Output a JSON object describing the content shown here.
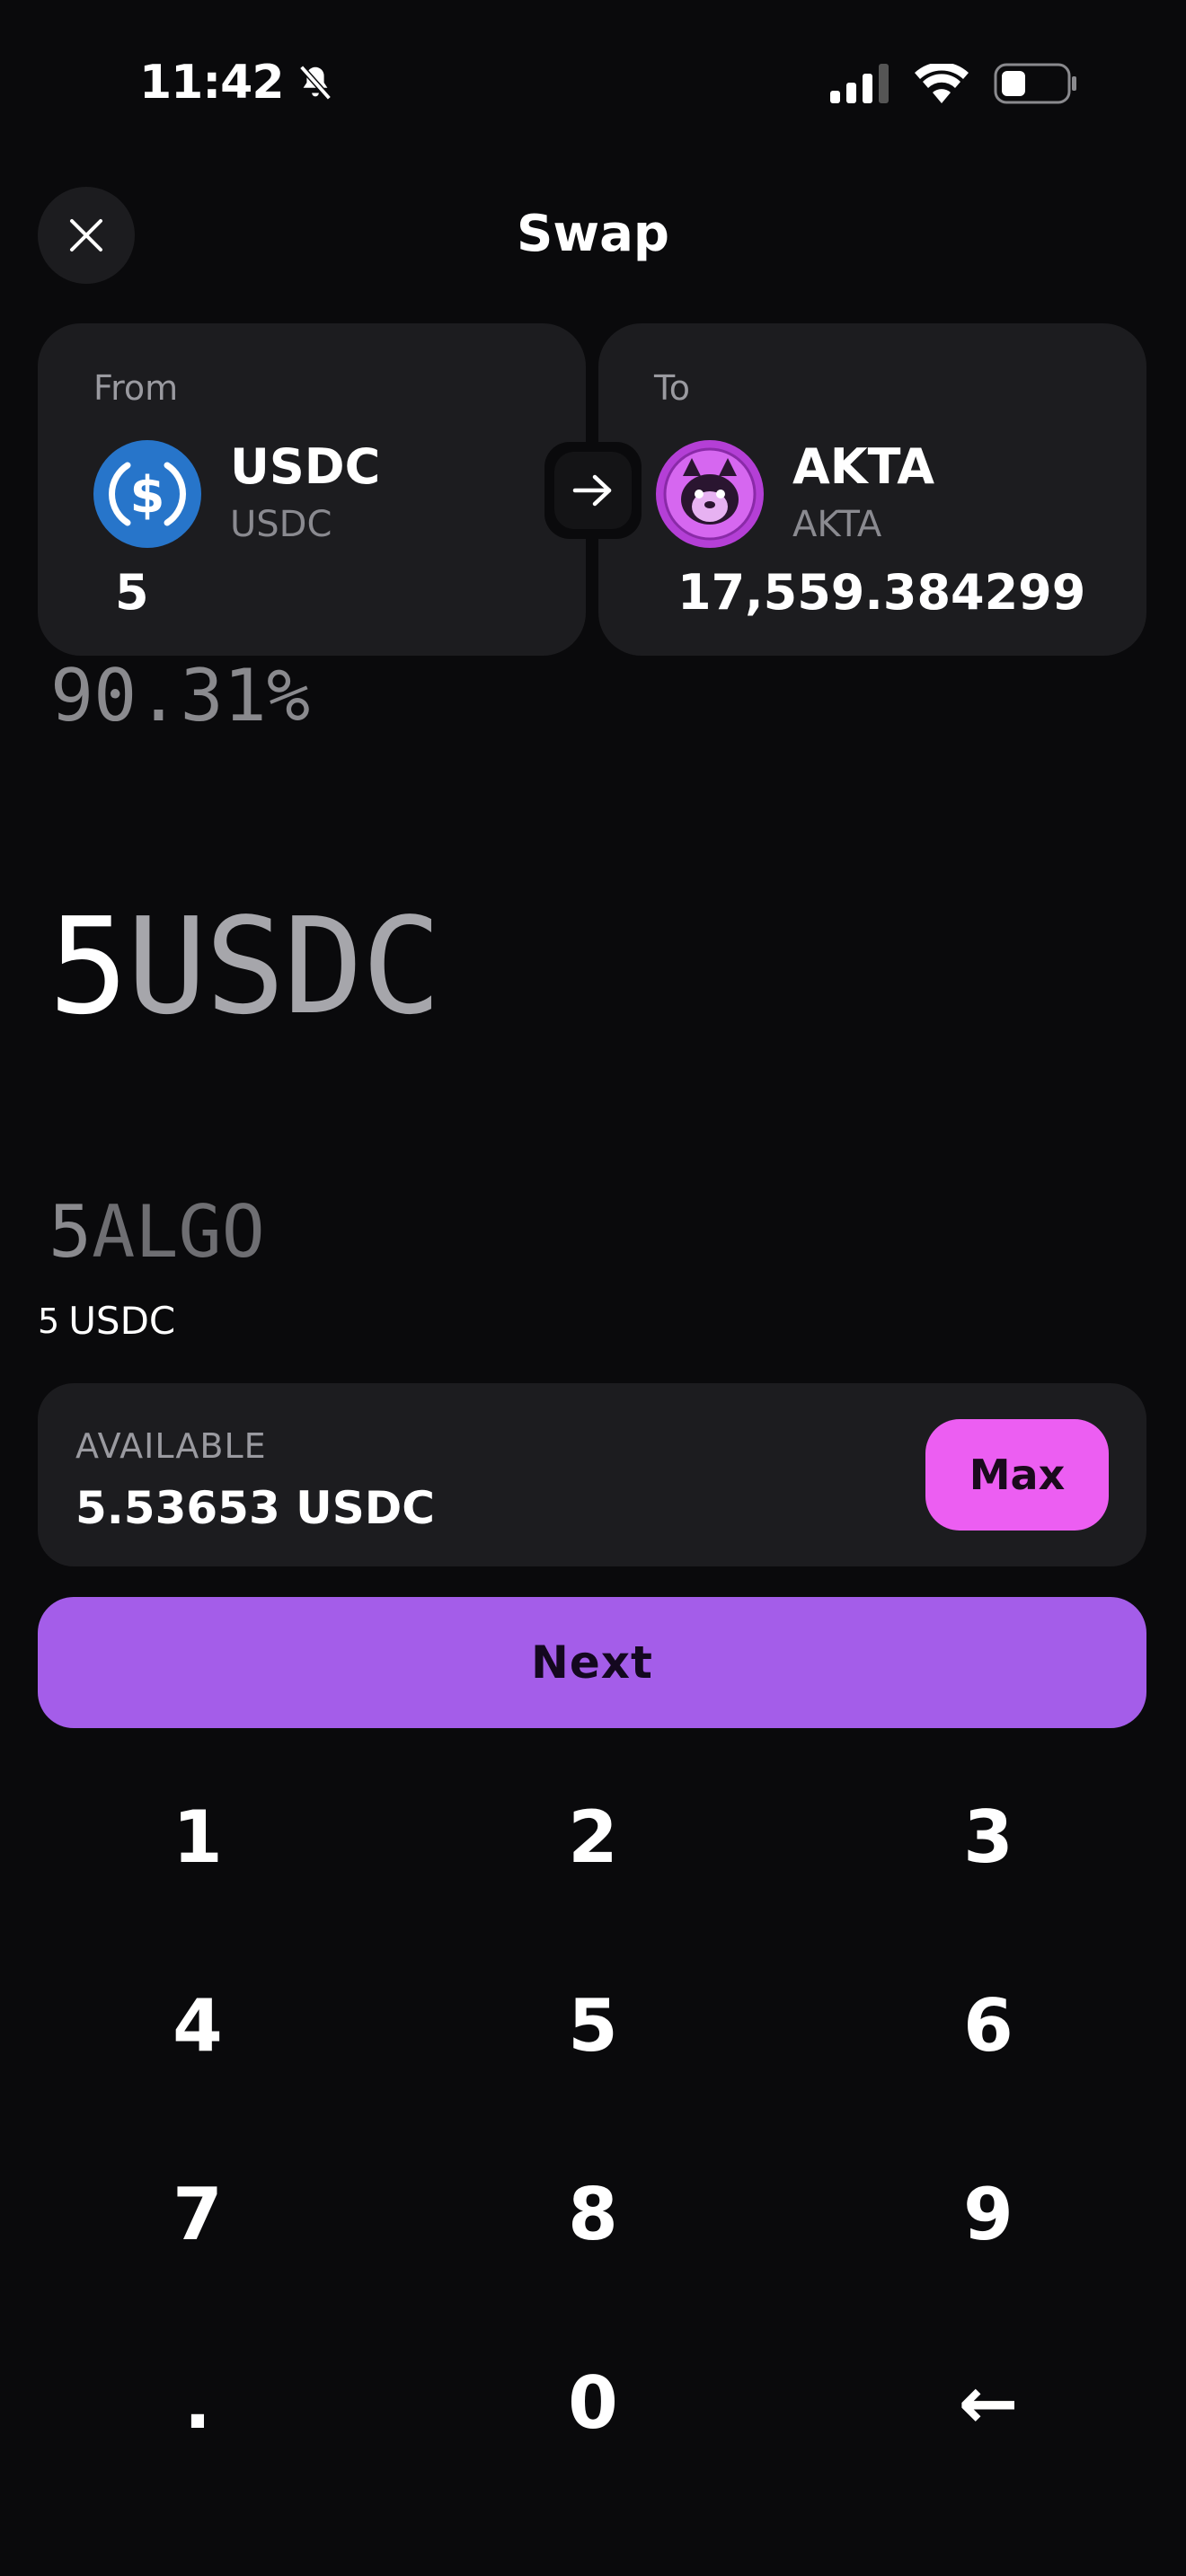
{
  "status_bar": {
    "time": "11:42"
  },
  "header": {
    "title": "Swap"
  },
  "from": {
    "label": "From",
    "token": "USDC",
    "ticker": "USDC",
    "amount": "5",
    "color": "#2775ca"
  },
  "to": {
    "label": "To",
    "token": "AKTA",
    "ticker": "AKTA",
    "amount": "17,559.384299",
    "color": "#c446e6"
  },
  "display": {
    "percent": "90.31%",
    "amount": "5",
    "unit": "USDC",
    "alt_amount": "5",
    "alt_unit": "ALGO",
    "summary_amount": "5",
    "summary_unit": "USDC"
  },
  "available": {
    "label": "AVAILABLE",
    "value": "5.53653 USDC",
    "max_label": "Max"
  },
  "next_label": "Next",
  "keypad": [
    "1",
    "2",
    "3",
    "4",
    "5",
    "6",
    "7",
    "8",
    "9",
    ".",
    "0",
    "←"
  ],
  "colors": {
    "accent": "#a45de9",
    "max": "#ec5ef2",
    "background": "#0a0a0c",
    "card": "#1c1c1f"
  }
}
